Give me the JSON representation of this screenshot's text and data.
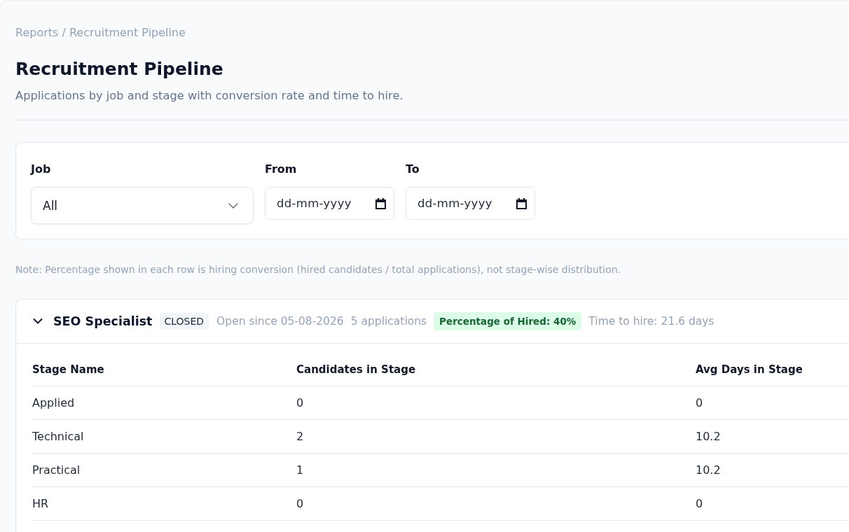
{
  "breadcrumb": "Reports / Recruitment Pipeline",
  "page": {
    "title": "Recruitment Pipeline",
    "subtitle": "Applications by job and stage with conversion rate and time to hire."
  },
  "filters": [
    {
      "kind": "select",
      "label": "Job",
      "value": "All"
    },
    {
      "kind": "date",
      "label": "From",
      "placeholder": "dd-mm-yyyy"
    },
    {
      "kind": "date",
      "label": "To",
      "placeholder": "dd-mm-yyyy"
    }
  ],
  "note": "Note: Percentage shown in each row is hiring conversion (hired candidates / total applications), not stage-wise distribution.",
  "jobs": [
    {
      "title": "SEO Specialist",
      "expanded": true,
      "status": "CLOSED",
      "open_since": "Open since 05-08-2026",
      "applications": "5 applications",
      "hired_rate": "Percentage of Hired: 40%",
      "time_to_hire": "Time to hire: 21.6 days",
      "table": {
        "columns": [
          "Stage Name",
          "Candidates in Stage",
          "Avg Days in Stage"
        ],
        "rows": [
          [
            "Applied",
            "0",
            "0"
          ],
          [
            "Technical",
            "2",
            "10.2"
          ],
          [
            "Practical",
            "1",
            "10.2"
          ],
          [
            "HR",
            "0",
            "0"
          ]
        ]
      }
    }
  ]
}
